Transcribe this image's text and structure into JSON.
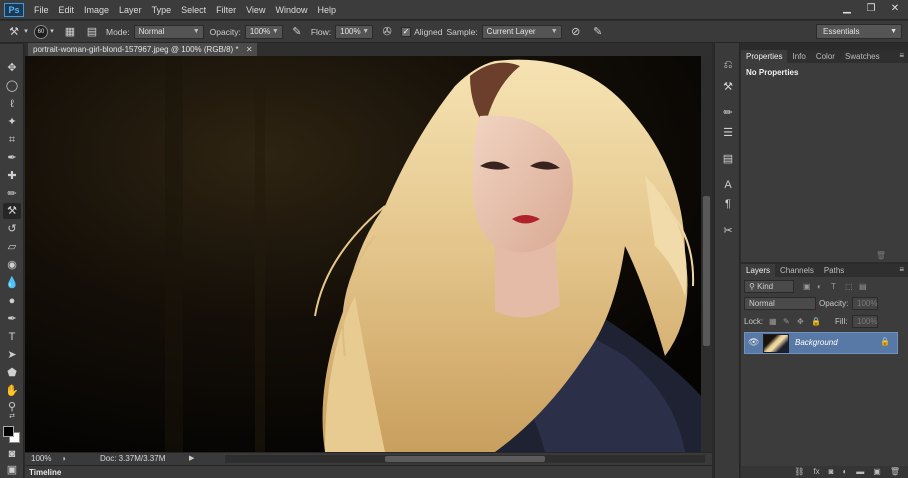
{
  "app": {
    "logo_text": "Ps"
  },
  "menu": {
    "items": [
      "File",
      "Edit",
      "Image",
      "Layer",
      "Type",
      "Select",
      "Filter",
      "View",
      "Window",
      "Help"
    ]
  },
  "window_controls": {
    "minimize": "▁",
    "restore": "❐",
    "close": "✕"
  },
  "options_bar": {
    "brush_size": "60",
    "mode_label": "Mode:",
    "mode_value": "Normal",
    "opacity_label": "Opacity:",
    "opacity_value": "100%",
    "flow_label": "Flow:",
    "flow_value": "100%",
    "aligned_label": "Aligned",
    "aligned_checked": true,
    "sample_label": "Sample:",
    "sample_value": "Current Layer",
    "workspace": "Essentials"
  },
  "document": {
    "tab_title": "portrait-woman-girl-blond-157967.jpeg @ 100% (RGB/8) *",
    "zoom": "100%",
    "doc_size": "Doc: 3.37M/3.37M"
  },
  "timeline": {
    "label": "Timeline"
  },
  "properties_panel": {
    "tabs": [
      "Properties",
      "Info",
      "Color",
      "Swatches"
    ],
    "active_tab": "Properties",
    "content": "No Properties"
  },
  "layers_panel": {
    "tabs": [
      "Layers",
      "Channels",
      "Paths"
    ],
    "active_tab": "Layers",
    "filter_kind": "Kind",
    "blend_mode": "Normal",
    "opacity_label": "Opacity:",
    "opacity_value": "100%",
    "lock_label": "Lock:",
    "fill_label": "Fill:",
    "fill_value": "100%",
    "layers": [
      {
        "name": "Background",
        "visible": true,
        "locked": true,
        "selected": true
      }
    ]
  },
  "colors": {
    "foreground": "#000000",
    "background": "#ffffff",
    "selection_blue": "#5879a5"
  }
}
